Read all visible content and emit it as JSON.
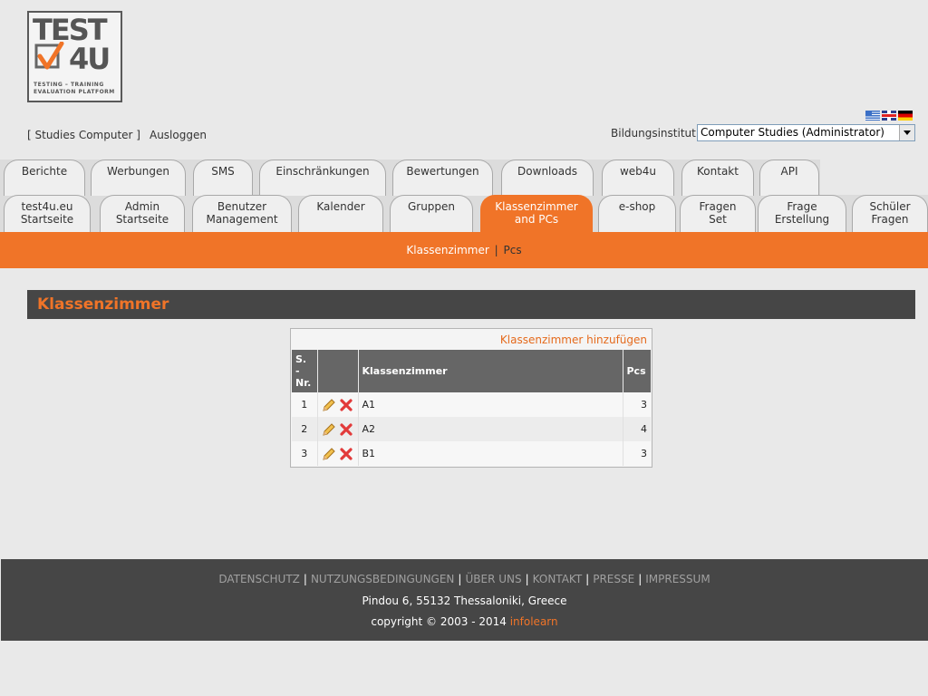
{
  "logo": {
    "line1": "TEST",
    "line2": "4U",
    "tagline1": "TESTING – TRAINING",
    "tagline2": "EVALUATION PLATFORM"
  },
  "user": {
    "account_link": "[ Studies Computer ]",
    "logout_link": "Ausloggen"
  },
  "languages": [
    "greek-flag-icon",
    "uk-flag-icon",
    "german-flag-icon"
  ],
  "institute": {
    "label": "Bildungsinstitut:",
    "selected": "Computer Studies (Administrator)"
  },
  "tabs_row1": [
    {
      "label": "Berichte"
    },
    {
      "label": "Werbungen"
    },
    {
      "label": "SMS"
    },
    {
      "label": "Einschränkungen"
    },
    {
      "label": "Bewertungen"
    },
    {
      "label": "Downloads"
    },
    {
      "label": "web4u"
    },
    {
      "label": "Kontakt"
    },
    {
      "label": "API"
    }
  ],
  "tabs_row2": [
    {
      "line1": "test4u.eu",
      "line2": "Startseite"
    },
    {
      "line1": "Admin",
      "line2": "Startseite"
    },
    {
      "line1": "Benutzer",
      "line2": "Management"
    },
    {
      "line1": "Kalender",
      "line2": ""
    },
    {
      "line1": "Gruppen",
      "line2": ""
    },
    {
      "line1": "Klassenzimmer",
      "line2": "and PCs"
    },
    {
      "line1": "e-shop",
      "line2": ""
    },
    {
      "line1": "Fragen",
      "line2": "Set"
    },
    {
      "line1": "Frage",
      "line2": "Erstellung"
    },
    {
      "line1": "Schüler",
      "line2": "Fragen"
    }
  ],
  "subnav": {
    "current": "Klassenzimmer",
    "separator": "|",
    "other": "Pcs"
  },
  "section": {
    "title": "Klassenzimmer"
  },
  "classrooms": {
    "add_link": "Klassenzimmer hinzufügen",
    "headers": {
      "nr_line1": "S.",
      "nr_line2": "-",
      "nr_line3": "Nr.",
      "name": "Klassenzimmer",
      "pcs": "Pcs"
    },
    "rows": [
      {
        "nr": "1",
        "name": "A1",
        "pcs": "3"
      },
      {
        "nr": "2",
        "name": "A2",
        "pcs": "4"
      },
      {
        "nr": "3",
        "name": "B1",
        "pcs": "3"
      }
    ]
  },
  "footer": {
    "links": [
      "DATENSCHUTZ",
      "NUTZUNGSBEDINGUNGEN",
      "ÜBER UNS",
      "KONTAKT",
      "PRESSE",
      "IMPRESSUM"
    ],
    "separator": "|",
    "address": "Pindou 6, 55132 Thessaloniki, Greece",
    "copyright_prefix": "copyright © 2003 - 2014",
    "brand": "infolearn"
  },
  "colors": {
    "accent": "#f07428",
    "dark": "#464646",
    "background": "#e9e9e9"
  }
}
